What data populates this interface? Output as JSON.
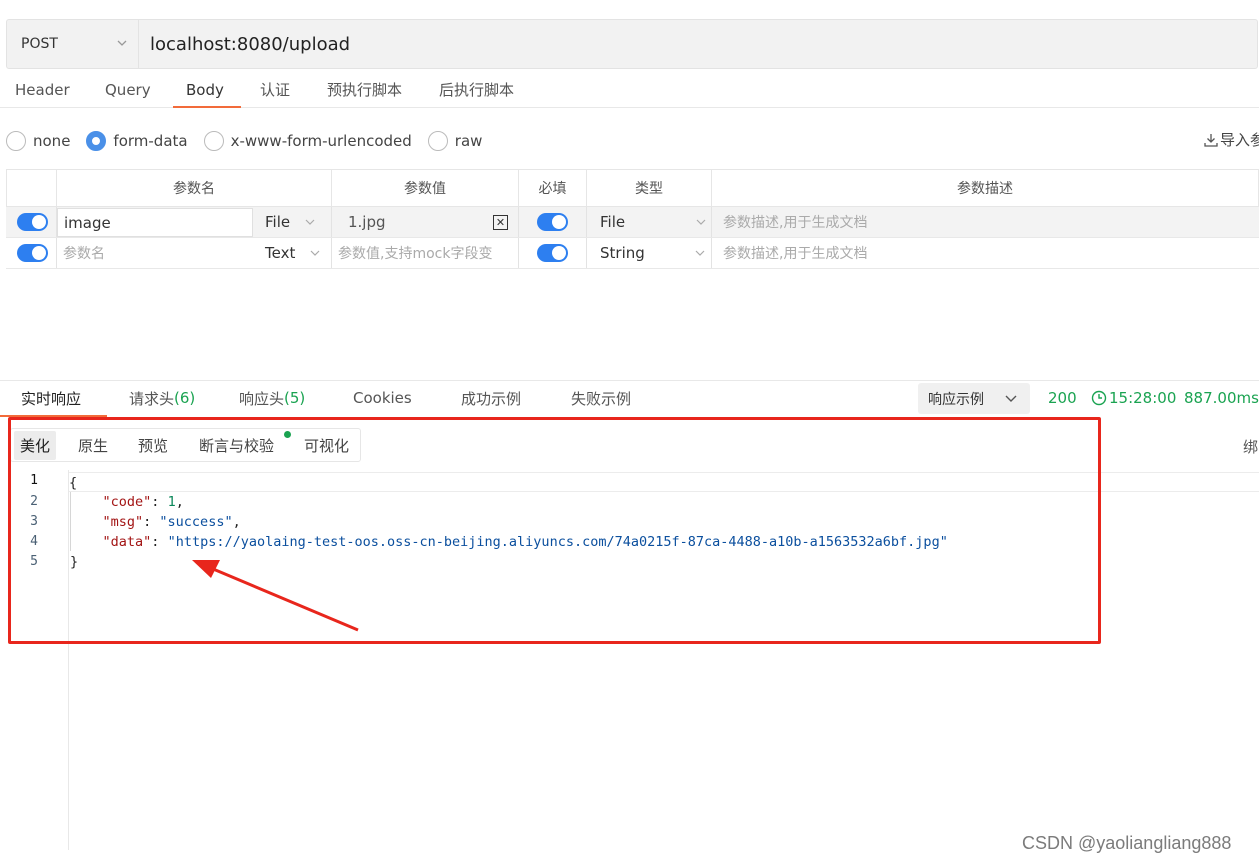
{
  "request": {
    "method": "POST",
    "url": "localhost:8080/upload"
  },
  "request_tabs": [
    "Header",
    "Query",
    "Body",
    "认证",
    "预执行脚本",
    "后执行脚本"
  ],
  "active_request_tab": "Body",
  "body_types": [
    "none",
    "form-data",
    "x-www-form-urlencoded",
    "raw"
  ],
  "selected_body_type": "form-data",
  "import_label": "导入参",
  "params_table": {
    "headers": [
      "参数名",
      "参数值",
      "必填",
      "类型",
      "参数描述"
    ],
    "rows": [
      {
        "enabled": true,
        "name": "image",
        "name_placeholder": "",
        "input_type": "File",
        "value": "1.jpg",
        "value_placeholder": "",
        "required": true,
        "type": "File",
        "description_placeholder": "参数描述,用于生成文档"
      },
      {
        "enabled": true,
        "name": "",
        "name_placeholder": "参数名",
        "input_type": "Text",
        "value": "",
        "value_placeholder": "参数值,支持mock字段变",
        "required": true,
        "type": "String",
        "description_placeholder": "参数描述,用于生成文档"
      }
    ]
  },
  "response_tabs": [
    {
      "label": "实时响应",
      "count": ""
    },
    {
      "label": "请求头",
      "count": "(6)"
    },
    {
      "label": "响应头",
      "count": "(5)"
    },
    {
      "label": "Cookies",
      "count": ""
    },
    {
      "label": "成功示例",
      "count": ""
    },
    {
      "label": "失败示例",
      "count": ""
    }
  ],
  "response_example_select": "响应示例",
  "response_status": {
    "code": "200",
    "time": "15:28:00",
    "duration": "887.00ms"
  },
  "view_tabs": [
    "美化",
    "原生",
    "预览",
    "断言与校验",
    "可视化"
  ],
  "active_view_tab": "美化",
  "bind_label": "绑",
  "response_lines": [
    {
      "num": "1",
      "text": "{"
    },
    {
      "num": "2",
      "key": "\"code\"",
      "value": "1",
      "suffix": ","
    },
    {
      "num": "3",
      "key": "\"msg\"",
      "value": "\"success\"",
      "suffix": ","
    },
    {
      "num": "4",
      "key": "\"data\"",
      "value": "\"https://yaolaing-test-oos.oss-cn-beijing.aliyuncs.com/74a0215f-87ca-4488-a10b-a1563532a6bf.jpg\"",
      "suffix": ""
    },
    {
      "num": "5",
      "text": "}"
    }
  ],
  "colors": {
    "accent_tab": "#f26b3a",
    "toggle_blue": "#2d7ff0",
    "status_green": "#1aa351",
    "annotation_red": "#e8261c"
  },
  "icons": [
    "chevron-down-icon",
    "clock-icon",
    "download-icon",
    "clear-file-icon",
    "arrow-annotation"
  ],
  "watermark": "CSDN @yaoliangliang888"
}
